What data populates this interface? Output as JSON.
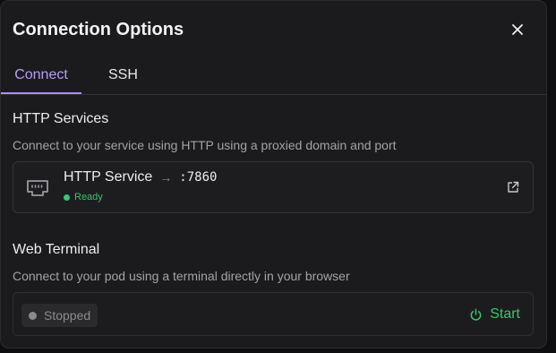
{
  "dialog": {
    "title": "Connection Options"
  },
  "tabs": [
    {
      "label": "Connect",
      "active": true
    },
    {
      "label": "SSH",
      "active": false
    }
  ],
  "http_section": {
    "title": "HTTP Services",
    "description": "Connect to your service using HTTP using a proxied domain and port",
    "service": {
      "name": "HTTP Service",
      "arrow": "→",
      "port": ":7860",
      "status": "Ready",
      "status_color": "#3ec46d",
      "icon": "ethernet-port-icon"
    }
  },
  "terminal_section": {
    "title": "Web Terminal",
    "description": "Connect to your pod using a terminal directly in your browser",
    "status": "Stopped",
    "status_color": "#8a8a8f",
    "start_label": "Start",
    "start_color": "#3ec46d"
  },
  "colors": {
    "accent": "#a98ef5",
    "success": "#3ec46d",
    "panel": "#1b1b1d"
  }
}
